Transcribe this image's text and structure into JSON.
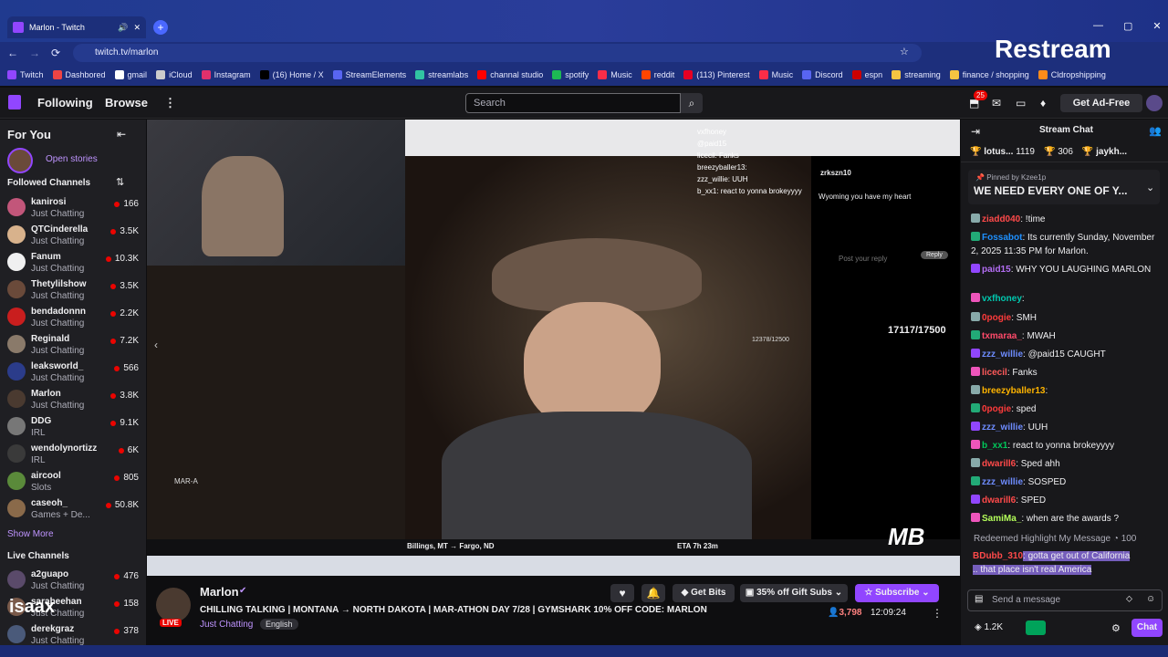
{
  "browser": {
    "tab_title": "Marlon - Twitch",
    "url": "twitch.tv/marlon",
    "restream": "Restream",
    "bookmarks": [
      "Twitch",
      "Dashbored",
      "gmail",
      "iCloud",
      "Instagram",
      "(16) Home / X",
      "StreamElements",
      "streamlabs",
      "channal studio",
      "spotify",
      "Music",
      "reddit",
      "(113) Pinterest",
      "Music",
      "Discord",
      "espn",
      "streaming",
      "finance / shopping",
      "Cldropshipping"
    ]
  },
  "nav": {
    "following": "Following",
    "browse": "Browse",
    "search_placeholder": "Search",
    "notif_count": "25",
    "ad_free": "Get Ad-Free"
  },
  "sidebar": {
    "for_you": "For You",
    "open_stories": "Open stories",
    "followed": "Followed Channels",
    "show_more": "Show More",
    "live": "Live Channels",
    "channels": [
      {
        "name": "kanirosi",
        "cat": "Just Chatting",
        "viewers": "166",
        "color": "#c2567a"
      },
      {
        "name": "QTCinderella",
        "cat": "Just Chatting",
        "viewers": "3.5K",
        "color": "#d8b28c"
      },
      {
        "name": "Fanum",
        "cat": "Just Chatting",
        "viewers": "10.3K",
        "color": "#f0f0f0"
      },
      {
        "name": "Thetylilshow",
        "cat": "Just Chatting",
        "viewers": "3.5K",
        "color": "#6a4a3a"
      },
      {
        "name": "bendadonnn",
        "cat": "Just Chatting",
        "viewers": "2.2K",
        "color": "#c91e1e"
      },
      {
        "name": "Reginald",
        "cat": "Just Chatting",
        "viewers": "7.2K",
        "color": "#8a7a6a"
      },
      {
        "name": "leaksworld_",
        "cat": "Just Chatting",
        "viewers": "566",
        "color": "#2b3c8a"
      },
      {
        "name": "Marlon",
        "cat": "Just Chatting",
        "viewers": "3.8K",
        "color": "#4a3a30"
      },
      {
        "name": "DDG",
        "cat": "IRL",
        "viewers": "9.1K",
        "color": "#777"
      },
      {
        "name": "wendolynortizz",
        "cat": "IRL",
        "viewers": "6K",
        "color": "#3a3a3a"
      },
      {
        "name": "aircool",
        "cat": "Slots",
        "viewers": "805",
        "color": "#5a8a3a"
      },
      {
        "name": "caseoh_",
        "cat": "Games + De...",
        "viewers": "50.8K",
        "color": "#8a6a4a"
      }
    ],
    "live_channels": [
      {
        "name": "a2guapo",
        "cat": "Just Chatting",
        "viewers": "476",
        "color": "#5a4a6a"
      },
      {
        "name": "saraheehan",
        "cat": "Just Chatting",
        "viewers": "158",
        "color": "#7a5a4a"
      },
      {
        "name": "derekgraz",
        "cat": "Just Chatting",
        "viewers": "378",
        "color": "#4a5a7a"
      }
    ]
  },
  "video": {
    "counter": "17117/17500",
    "small_counter": "12378/12500",
    "tweet_user": "zrkszn10",
    "tweet_text": "Wyoming you have my heart",
    "tweet_reply": "Post your reply",
    "reply_btn": "Reply",
    "route": "Billings, MT → Fargo, ND",
    "eta": "ETA 7h 23m",
    "marathon": "MAR-A",
    "overlay_chat": [
      "vxfhoney",
      "@paid15",
      "licecil: Fanks",
      "breezyballer13:",
      "zzz_willie: UUH",
      "b_xx1: react to yonna brokeyyyy"
    ],
    "watermark": "isaax"
  },
  "stream": {
    "streamer": "Marlon",
    "title": "CHILLING TALKING | MONTANA → NORTH DAKOTA | MAR-ATHON DAY 7/28 | GYMSHARK 10% OFF CODE: MARLON",
    "category": "Just Chatting",
    "tag": "English",
    "live": "LIVE",
    "viewers": "3,798",
    "uptime": "12:09:24",
    "get_bits": "Get Bits",
    "gift": "35% off Gift Subs",
    "subscribe": "Subscribe"
  },
  "chat": {
    "title": "Stream Chat",
    "pinned_by": "Pinned by",
    "pinner": "Kzee1p",
    "pinned_msg": "WE NEED EVERY ONE OF Y...",
    "leaderboard": [
      {
        "name": "lotus...",
        "amt": "1119"
      },
      {
        "name": "",
        "amt": "306"
      },
      {
        "name": "jaykh...",
        "amt": ""
      }
    ],
    "messages": [
      {
        "user": "ziadd040",
        "text": ": !time",
        "color": "#ff4a4a"
      },
      {
        "user": "Fossabot",
        "text": ": Its currently Sunday, November 2, 2025 11:35 PM for Marlon.",
        "color": "#1e90ff"
      },
      {
        "user": "paid15",
        "text": ": WHY YOU LAUGHING MARLON",
        "color": "#b46ef5"
      },
      {
        "user": "vxfhoney",
        "text": ":",
        "color": "#00c8af"
      },
      {
        "user": "0pogie",
        "text": ": SMH",
        "color": "#ff3b3b"
      },
      {
        "user": "txmaraa_",
        "text": ": MWAH",
        "color": "#ff4a6a"
      },
      {
        "user": "zzz_willie",
        "text": ": @paid15 CAUGHT",
        "color": "#6e8cff"
      },
      {
        "user": "licecil",
        "text": ": Fanks",
        "color": "#ff5a5a"
      },
      {
        "user": "breezyballer13",
        "text": ":",
        "color": "#ffb400"
      },
      {
        "user": "0pogie",
        "text": ": sped",
        "color": "#ff3b3b"
      },
      {
        "user": "zzz_willie",
        "text": ": UUH",
        "color": "#6e8cff"
      },
      {
        "user": "b_xx1",
        "text": ": react to yonna brokeyyyy",
        "color": "#00c85a"
      },
      {
        "user": "dwarill6",
        "text": ": Sped ahh",
        "color": "#ff4a4a"
      },
      {
        "user": "zzz_willie",
        "text": ": SOSPED",
        "color": "#6e8cff"
      },
      {
        "user": "dwarill6",
        "text": ": SPED",
        "color": "#ff4a4a"
      },
      {
        "user": "SamiMa_",
        "text": ": when are the awards ?",
        "color": "#b4ff5a"
      }
    ],
    "redeemed": "Redeemed Highlight My Message",
    "redeemed_cost": "100",
    "highlight_user": "BDubb_310",
    "highlight_text": ": gotta get out of California .. that place isn't real America",
    "placeholder": "Send a message",
    "points": "1.2K",
    "chat_btn": "Chat"
  }
}
